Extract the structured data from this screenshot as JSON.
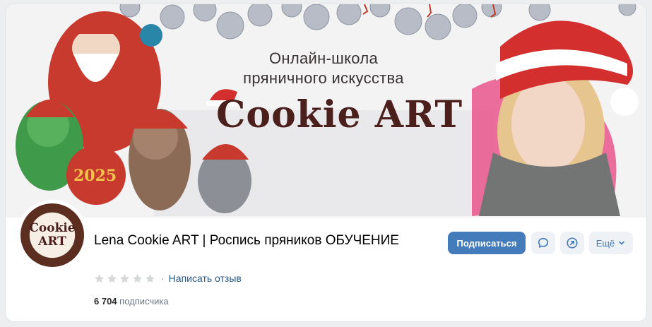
{
  "cover": {
    "subtitle_line1": "Онлайн-школа",
    "subtitle_line2": "пряничного искусства",
    "logo_text": "Cookie ART",
    "ornament_text": "2025"
  },
  "avatar": {
    "line1": "Cookie",
    "line2": "ART"
  },
  "group": {
    "title": "Lena Cookie ART | Роспись пряников ОБУЧЕНИЕ",
    "review_link": "Написать отзыв",
    "rating_stars": 0,
    "subscriber_count": "6 704",
    "subscriber_label": "подписчика"
  },
  "actions": {
    "subscribe_label": "Подписаться",
    "more_label": "Ещё",
    "message_icon": "message-icon",
    "share_icon": "share-icon"
  },
  "colors": {
    "accent": "#447bba",
    "link": "#2a5885",
    "muted": "#818c99"
  }
}
